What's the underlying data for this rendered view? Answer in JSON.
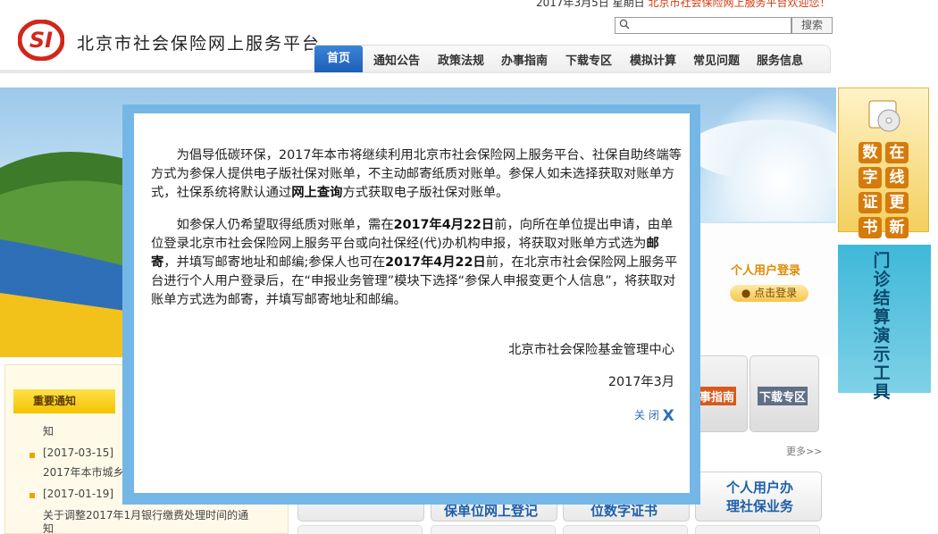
{
  "header": {
    "date_line": "2017年3月5日 星期日",
    "welcome": "北京市社会保险网上服务平台欢迎您！",
    "site_title": "北京市社会保险网上服务平台",
    "search": {
      "placeholder": "",
      "button_label": "搜索"
    },
    "nav": [
      {
        "label": "首页",
        "active": true
      },
      {
        "label": "通知公告"
      },
      {
        "label": "政策法规"
      },
      {
        "label": "办事指南"
      },
      {
        "label": "下载专区"
      },
      {
        "label": "模拟计算"
      },
      {
        "label": "常见问题"
      },
      {
        "label": "服务信息"
      }
    ]
  },
  "login": {
    "title": "个人用户登录",
    "button_label": "点击登录"
  },
  "side_ads": {
    "ad1_chars": [
      "数",
      "在",
      "字",
      "线",
      "证",
      "更",
      "书",
      "新"
    ],
    "ad2_text": "门诊结算演示工具"
  },
  "notice": {
    "tab_label": "重要通知",
    "items": [
      {
        "text": "知"
      },
      {
        "date": "[2017-03-15]",
        "text": "2017年本市城乡居"
      },
      {
        "date": "[2017-01-19]",
        "text": "关于调整2017年1月银行缴费处理时间的通",
        "text2": "知"
      }
    ]
  },
  "quick_tiles": [
    "办事指南",
    "下载专区"
  ],
  "more_label": "更多>>",
  "services": [
    "个人用户办",
    "理社保业务"
  ],
  "service_partial": [
    "保单位网上登记",
    "位数字证书"
  ],
  "modal": {
    "para1_a": "为倡导低碳环保，2017年本市将继续利用北京市社会保险网上服务平台、社保自助终端等方式为参保人提供电子版社保对账单，不主动邮寄纸质对账单。参保人如未选择获取对账单方式，社保系统将默认通过",
    "para1_bold": "网上查询",
    "para1_b": "方式获取电子版社保对账单。",
    "para2_a": "如参保人仍希望取得纸质对账单，需在",
    "para2_date1": "2017年4月22日",
    "para2_b": "前，向所在单位提出申请，由单位登录北京市社会保险网上服务平台或向社保经(代)办机构申报，将获取对账单方式选为",
    "para2_bold2": "邮寄",
    "para2_c": "，并填写邮寄地址和邮编;参保人也可在",
    "para2_date2": "2017年4月22日",
    "para2_d": "前，在北京市社会保险网上服务平台进行个人用户登录后，在“申报业务管理”模块下选择“参保人申报变更个人信息”，将获取对账单方式选为邮寄，并填写邮寄地址和邮编。",
    "signature": "北京市社会保险基金管理中心",
    "date": "2017年3月",
    "close_label": "关 闭",
    "close_glyph": "X"
  },
  "colors": {
    "accent": "#1d5fb6",
    "modal_border": "#74b7e6",
    "logo_red": "#d1271b"
  }
}
